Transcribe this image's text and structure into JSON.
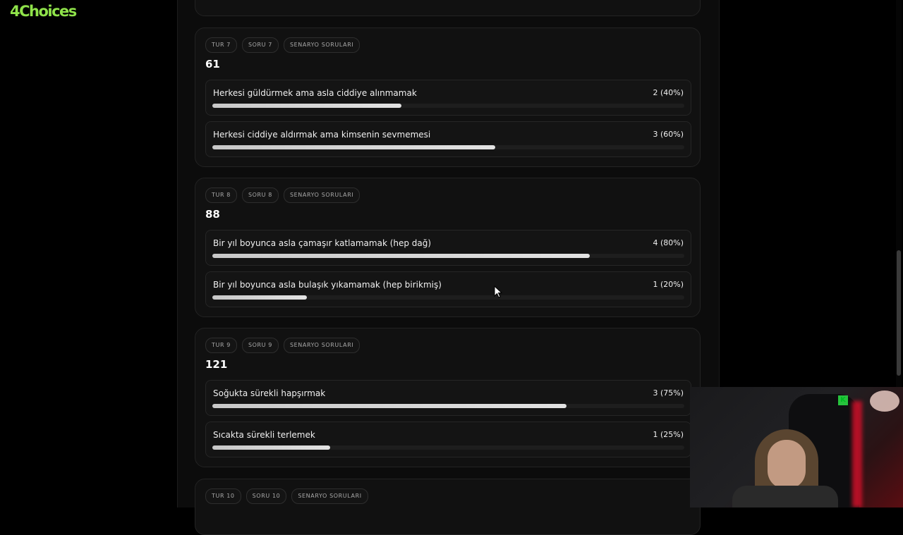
{
  "logo": {
    "prefix": "4",
    "text": "Choices"
  },
  "cards": [
    {
      "tags": [
        "TUR 7",
        "SORU 7",
        "SENARYO SORULARI"
      ],
      "number": "61",
      "options": [
        {
          "label": "Herkesi güldürmek ama asla ciddiye alınmamak",
          "count": "2 (40%)",
          "percent": 40
        },
        {
          "label": "Herkesi ciddiye aldırmak ama kimsenin sevmemesi",
          "count": "3 (60%)",
          "percent": 60
        }
      ]
    },
    {
      "tags": [
        "TUR 8",
        "SORU 8",
        "SENARYO SORULARI"
      ],
      "number": "88",
      "options": [
        {
          "label": "Bir yıl boyunca asla çamaşır katlamamak (hep dağ)",
          "count": "4 (80%)",
          "percent": 80
        },
        {
          "label": "Bir yıl boyunca asla bulaşık yıkamamak (hep birikmiş)",
          "count": "1 (20%)",
          "percent": 20
        }
      ]
    },
    {
      "tags": [
        "TUR 9",
        "SORU 9",
        "SENARYO SORULARI"
      ],
      "number": "121",
      "options": [
        {
          "label": "Soğukta sürekli hapşırmak",
          "count": "3 (75%)",
          "percent": 75
        },
        {
          "label": "Sıcakta sürekli terlemek",
          "count": "1 (25%)",
          "percent": 25
        }
      ]
    },
    {
      "tags": [
        "TUR 10",
        "SORU 10",
        "SENARYO SORULARI"
      ]
    }
  ],
  "webcam": {
    "overlay_icon": "K"
  }
}
